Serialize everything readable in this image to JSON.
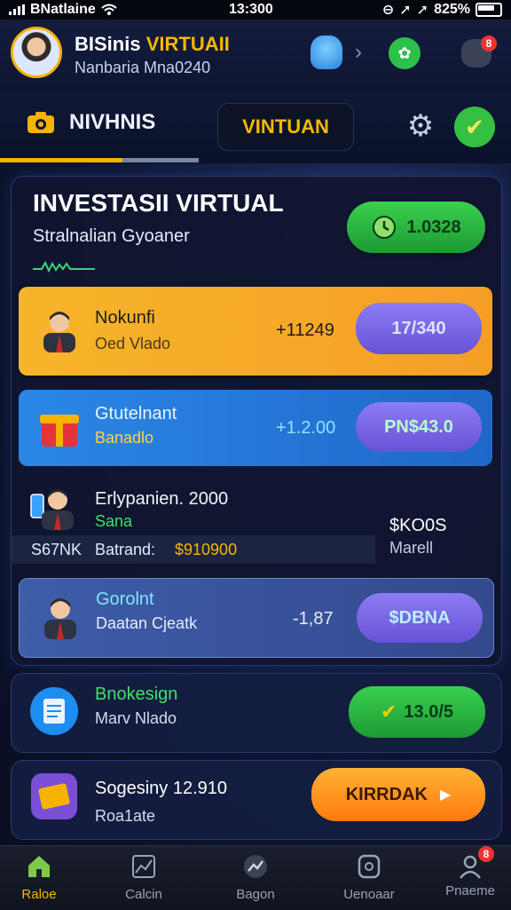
{
  "status_bar": {
    "carrier": "BNatlaine",
    "time": "13:300",
    "battery": "825%"
  },
  "header": {
    "app_name_prefix": "BISinis",
    "app_name_accent": "VIRTUAII",
    "subtitle": "Nanbaria Mna0240",
    "notification_badge": "8"
  },
  "tabs": {
    "tab1_label": "NIVHNIS",
    "tab2_label": "VINTUAN"
  },
  "panel": {
    "title": "INVESTASII VIRTUAL",
    "subtitle": "Stralnalian Gyoaner",
    "balance_pill": "1.0328"
  },
  "rows": [
    {
      "name": "Nokunfi",
      "sub": "Oed Vlado",
      "value": "+11249",
      "action": "17/340"
    },
    {
      "name": "Gtutelnant",
      "sub": "Banadlo",
      "value": "+1.2.00",
      "action": "PN$43.0"
    },
    {
      "name": "Erlypanien. 2000",
      "sub": "Sana",
      "right_top": "$KO0S",
      "right_bottom": "Marell",
      "footer_left": "S67NK",
      "footer_label": "Batrand:",
      "footer_value": "$910900"
    },
    {
      "name": "Gorolnt",
      "sub": "Daatan Cjeatk",
      "value": "-1,87",
      "action": "$DBNA"
    }
  ],
  "cards": [
    {
      "name": "Bnokesign",
      "sub": "Marv Nlado",
      "action": "13.0/5"
    },
    {
      "name": "Sogesiny 12.910",
      "sub": "Roa1ate",
      "action": "KIRRDAK"
    }
  ],
  "bottom_nav": {
    "items": [
      {
        "label": "Raloe"
      },
      {
        "label": "Calcin"
      },
      {
        "label": "Bagon"
      },
      {
        "label": "Uenoaar"
      },
      {
        "label": "Pnaeme"
      }
    ],
    "badge": "8"
  },
  "colors": {
    "accent": "#f5b300",
    "green": "#2fbe45",
    "purple": "#7a63e6",
    "orange": "#ff9a16",
    "blue": "#1f7fe0"
  }
}
